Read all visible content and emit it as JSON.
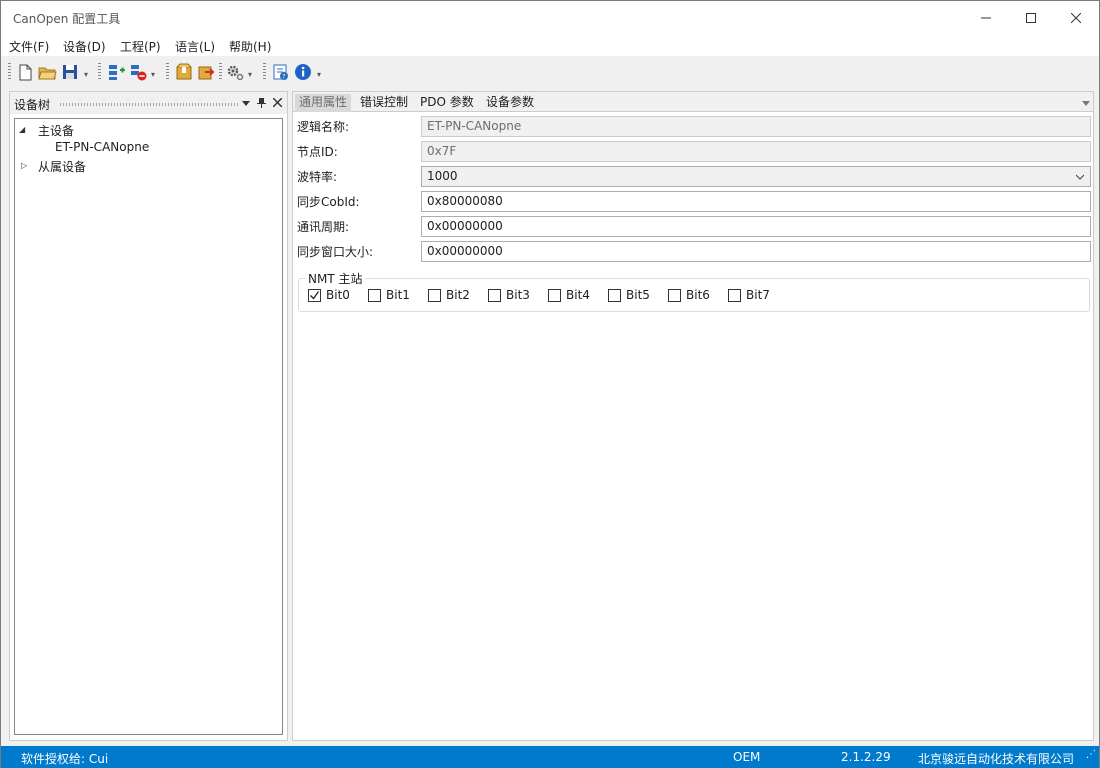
{
  "window": {
    "title": "CanOpen 配置工具"
  },
  "menu": [
    "文件(F)",
    "设备(D)",
    "工程(P)",
    "语言(L)",
    "帮助(H)"
  ],
  "toolbar": {
    "icons": [
      "new-file-icon",
      "open-folder-icon",
      "save-icon",
      "add-device-icon",
      "remove-device-icon",
      "package-icon",
      "export-icon",
      "settings-icon",
      "help-icon",
      "info-icon"
    ]
  },
  "device_tree": {
    "title": "设备树",
    "nodes": [
      {
        "label": "主设备",
        "expanded": true
      },
      {
        "label": "ET-PN-CANopne",
        "selected": true
      },
      {
        "label": "从属设备",
        "expanded": false
      }
    ]
  },
  "tabs": [
    "通用属性",
    "错误控制",
    "PDO 参数",
    "设备参数"
  ],
  "active_tab": "通用属性",
  "form": {
    "logic_name": {
      "label": "逻辑名称:",
      "value": "ET-PN-CANopne"
    },
    "node_id": {
      "label": "节点ID:",
      "value": "0x7F"
    },
    "baud_rate": {
      "label": "波特率:",
      "value": "1000"
    },
    "sync_cobid": {
      "label": "同步CobId:",
      "value": "0x80000080"
    },
    "comm_period": {
      "label": "通讯周期:",
      "value": "0x00000000"
    },
    "sync_window": {
      "label": "同步窗口大小:",
      "value": "0x00000000"
    }
  },
  "nmt": {
    "legend": "NMT 主站",
    "bits": [
      {
        "label": "Bit0",
        "checked": true
      },
      {
        "label": "Bit1",
        "checked": false
      },
      {
        "label": "Bit2",
        "checked": false
      },
      {
        "label": "Bit3",
        "checked": false
      },
      {
        "label": "Bit4",
        "checked": false
      },
      {
        "label": "Bit5",
        "checked": false
      },
      {
        "label": "Bit6",
        "checked": false
      },
      {
        "label": "Bit7",
        "checked": false
      }
    ]
  },
  "status": {
    "license": "软件授权给:   Cui",
    "edition": "OEM",
    "version": "2.1.2.29",
    "company": "北京骏远自动化技术有限公司"
  },
  "colors": {
    "statusbar": "#007acc",
    "accent": "#007acc"
  }
}
